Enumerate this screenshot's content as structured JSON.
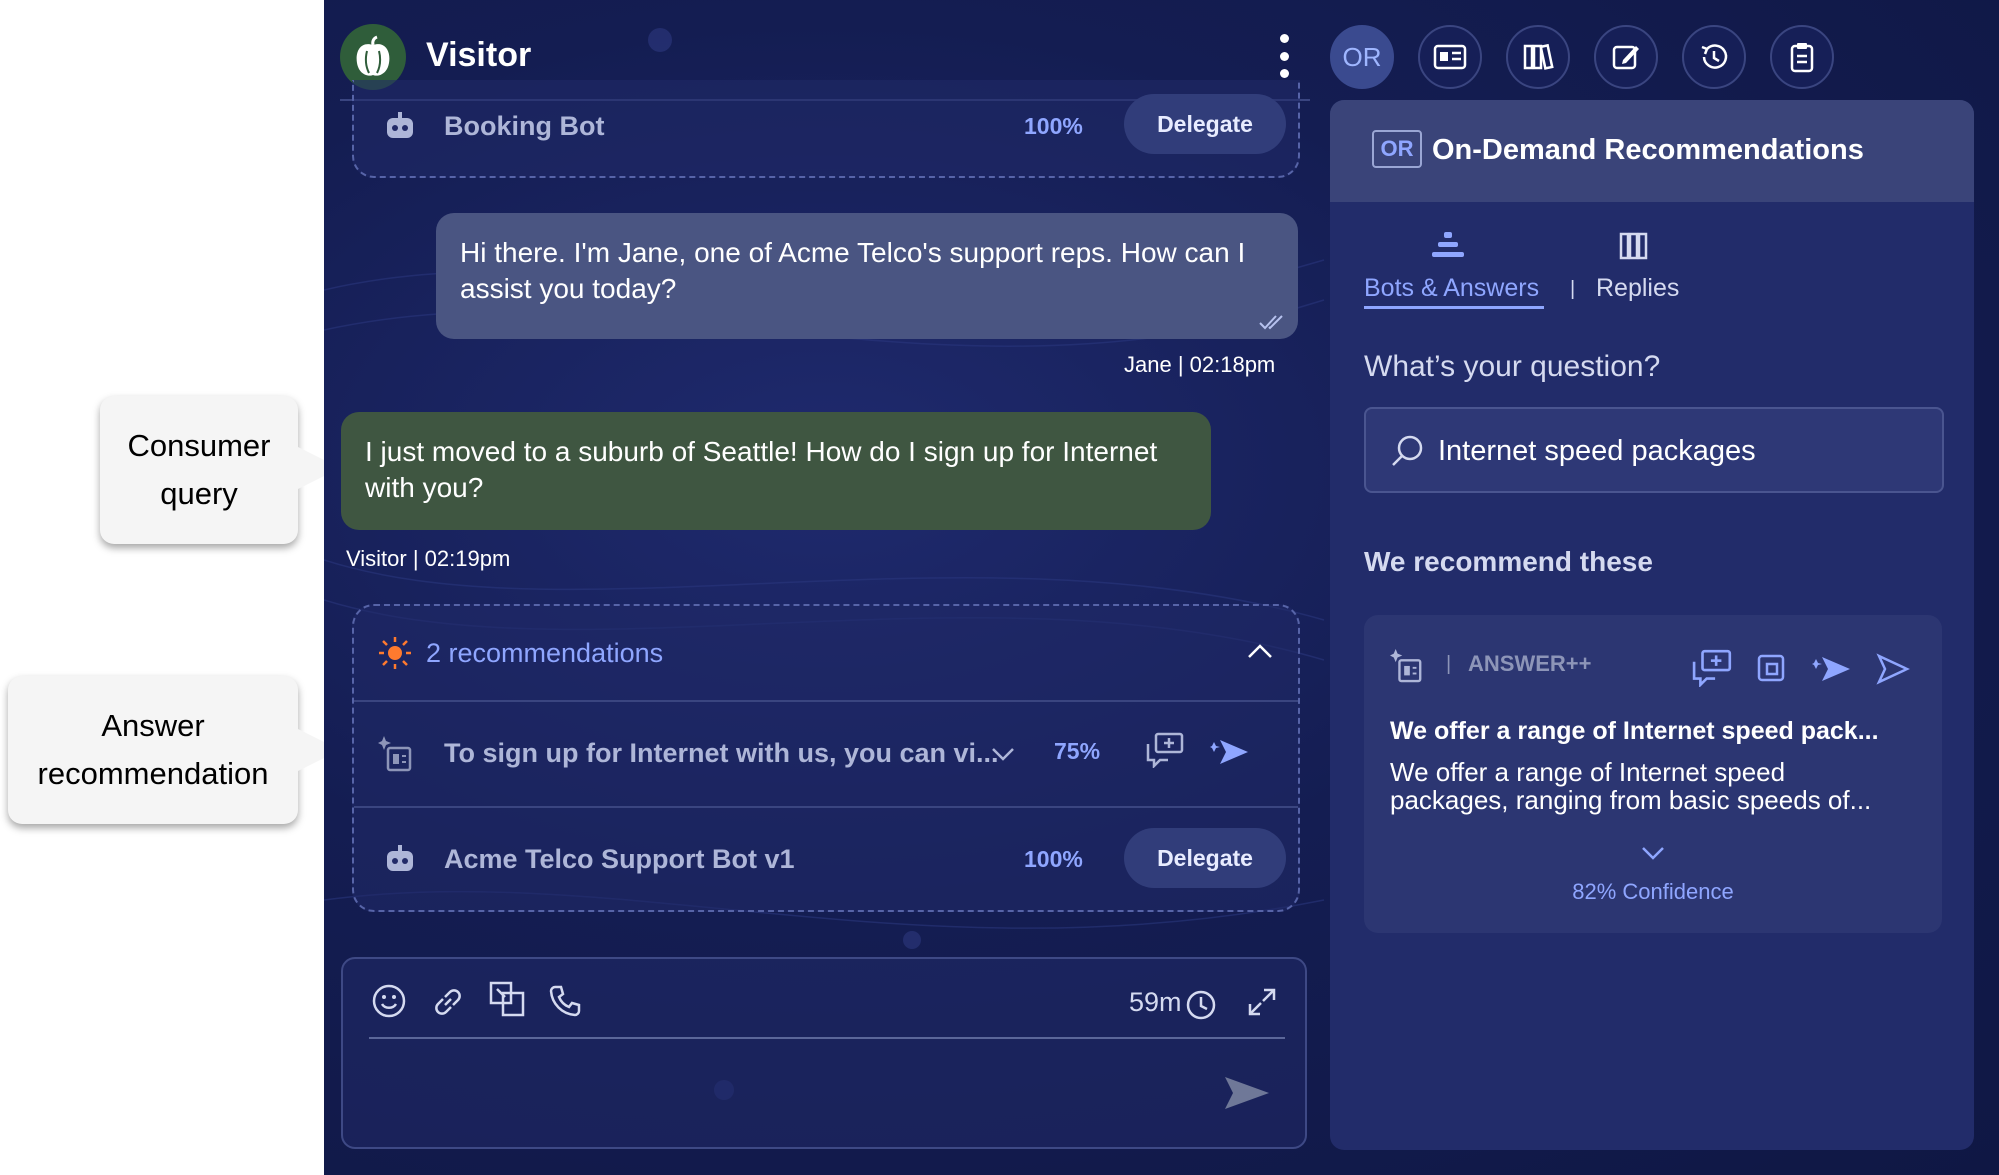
{
  "header": {
    "title": "Visitor",
    "or_button": "OR"
  },
  "booking_bot": {
    "name": "Booking Bot",
    "confidence": "100%",
    "action": "Delegate"
  },
  "messages": {
    "agent_text": "Hi there. I'm Jane, one of Acme Telco's support reps. How can I assist you today?",
    "agent_meta": "Jane | 02:18pm",
    "visitor_text": "I just moved to a suburb of Seattle! How do I sign up for Internet with you?",
    "visitor_meta": "Visitor | 02:19pm"
  },
  "recommendations": {
    "count_label": "2 recommendations",
    "answer_text": "To sign up for Internet with us, you can vi...",
    "answer_confidence": "75%",
    "bot_name": "Acme Telco Support Bot v1",
    "bot_confidence": "100%",
    "bot_action": "Delegate"
  },
  "composer": {
    "timer": "59m"
  },
  "panel": {
    "badge": "OR",
    "title": "On-Demand Recommendations",
    "tabs": [
      {
        "label": "Bots & Answers"
      },
      {
        "label": "Replies"
      }
    ],
    "tab_separator": "|",
    "question_label": "What’s your question?",
    "search_value": "Internet speed packages",
    "recommend_heading": "We recommend these",
    "card": {
      "type": "ANSWER++",
      "separator": "|",
      "title": "We offer a range of Internet speed pack...",
      "body_line1": "We offer a range of Internet speed",
      "body_line2": "packages, ranging from basic speeds of...",
      "confidence": "82% Confidence"
    }
  },
  "callouts": {
    "consumer_line1": "Consumer",
    "consumer_line2": "query",
    "answer_line1": "Answer",
    "answer_line2": "recommendation"
  },
  "colors": {
    "app_bg": "#141d52",
    "accent": "#8fa6ff",
    "visitor_bubble": "#3f5641",
    "agent_bubble": "#4a5582",
    "sun_icon": "#ff7a2e"
  }
}
